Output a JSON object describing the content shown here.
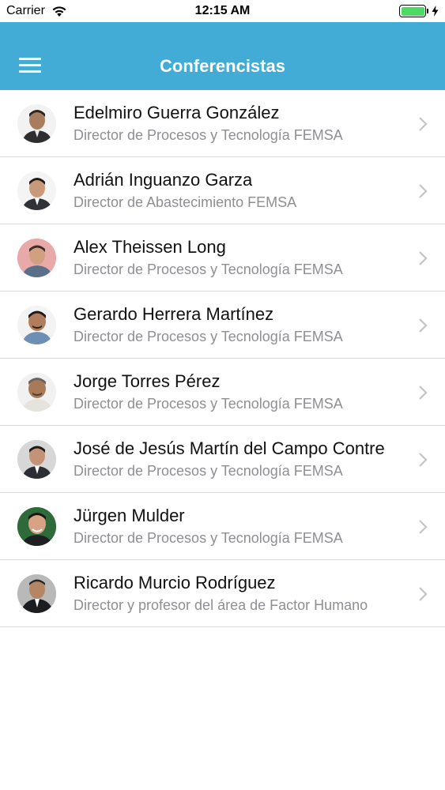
{
  "status_bar": {
    "carrier": "Carrier",
    "time": "12:15 AM",
    "battery_color": "#4cd964"
  },
  "nav": {
    "title": "Conferencistas",
    "menu_icon": "hamburger-menu-icon",
    "background": "#43acd6"
  },
  "speakers": [
    {
      "name": "Edelmiro Guerra González",
      "role": "Director de Procesos y Tecnología FEMSA"
    },
    {
      "name": "Adrián Inguanzo Garza",
      "role": "Director de Abastecimiento FEMSA"
    },
    {
      "name": "Alex Theissen Long",
      "role": "Director de Procesos y Tecnología FEMSA"
    },
    {
      "name": "Gerardo Herrera Martínez",
      "role": "Director de Procesos y Tecnología FEMSA"
    },
    {
      "name": "Jorge Torres Pérez",
      "role": "Director de Procesos y Tecnología FEMSA"
    },
    {
      "name": "José de Jesús Martín del Campo Contre",
      "role": "Director de Procesos y Tecnología FEMSA"
    },
    {
      "name": "Jürgen Mulder",
      "role": "Director de Procesos y Tecnología FEMSA"
    },
    {
      "name": "Ricardo Murcio Rodríguez",
      "role": "Director y profesor del área de Factor Humano"
    }
  ]
}
